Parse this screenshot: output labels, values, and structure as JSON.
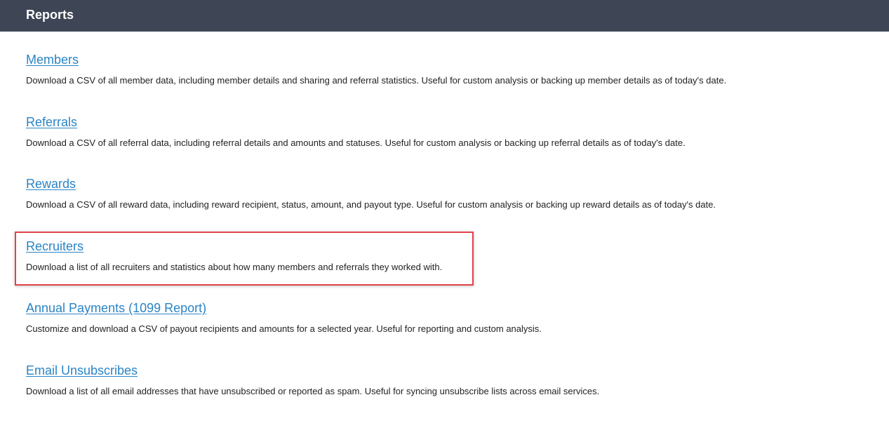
{
  "header": {
    "title": "Reports"
  },
  "colors": {
    "header_bg": "#3e4656",
    "link": "#2a84c5",
    "highlight": "#e0444a"
  },
  "reports": [
    {
      "title": "Members",
      "description": "Download a CSV of all member data, including member details and sharing and referral statistics. Useful for custom analysis or backing up member details as of today's date."
    },
    {
      "title": "Referrals",
      "description": "Download a CSV of all referral data, including referral details and amounts and statuses. Useful for custom analysis or backing up referral details as of today's date."
    },
    {
      "title": "Rewards",
      "description": "Download a CSV of all reward data, including reward recipient, status, amount, and payout type. Useful for custom analysis or backing up reward details as of today's date."
    },
    {
      "title": "Recruiters",
      "description": "Download a list of all recruiters and statistics about how many members and referrals they worked with."
    },
    {
      "title": "Annual Payments (1099 Report)",
      "description": "Customize and download a CSV of payout recipients and amounts for a selected year. Useful for reporting and custom analysis."
    },
    {
      "title": "Email Unsubscribes",
      "description": "Download a list of all email addresses that have unsubscribed or reported as spam. Useful for syncing unsubscribe lists across email services."
    }
  ]
}
